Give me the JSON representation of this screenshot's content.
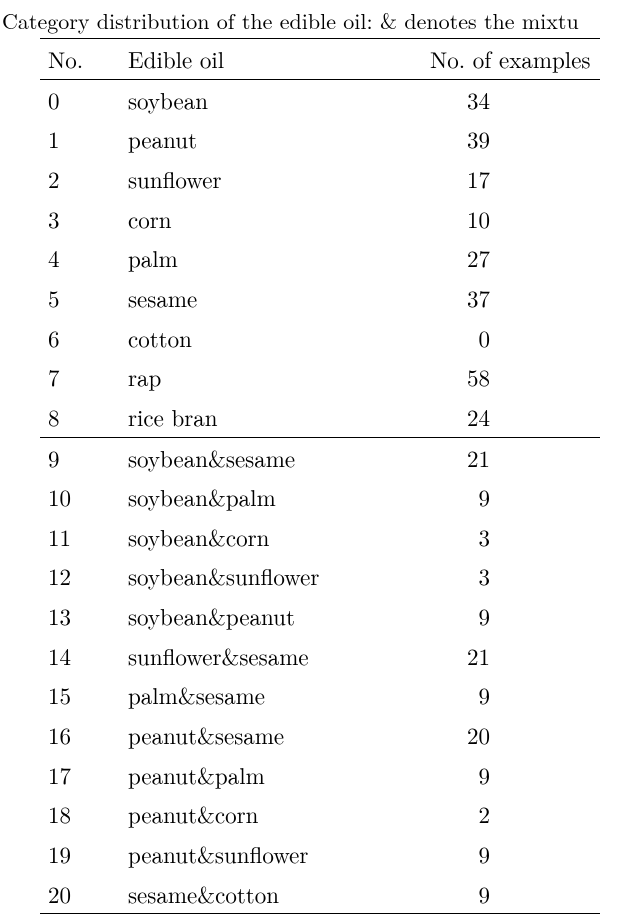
{
  "caption": "Category distribution of the edible oil: & denotes the mixtu",
  "columns": [
    "No.",
    "Edible oil",
    "No. of examples"
  ],
  "section_break_after": 8,
  "rows": [
    {
      "no": 0,
      "name": "soybean",
      "count": 34
    },
    {
      "no": 1,
      "name": "peanut",
      "count": 39
    },
    {
      "no": 2,
      "name": "sunflower",
      "count": 17
    },
    {
      "no": 3,
      "name": "corn",
      "count": 10
    },
    {
      "no": 4,
      "name": "palm",
      "count": 27
    },
    {
      "no": 5,
      "name": "sesame",
      "count": 37
    },
    {
      "no": 6,
      "name": "cotton",
      "count": 0
    },
    {
      "no": 7,
      "name": "rap",
      "count": 58
    },
    {
      "no": 8,
      "name": "rice bran",
      "count": 24
    },
    {
      "no": 9,
      "name": "soybean&sesame",
      "count": 21
    },
    {
      "no": 10,
      "name": "soybean&palm",
      "count": 9
    },
    {
      "no": 11,
      "name": "soybean&corn",
      "count": 3
    },
    {
      "no": 12,
      "name": "soybean&sunflower",
      "count": 3
    },
    {
      "no": 13,
      "name": "soybean&peanut",
      "count": 9
    },
    {
      "no": 14,
      "name": "sunflower&sesame",
      "count": 21
    },
    {
      "no": 15,
      "name": "palm&sesame",
      "count": 9
    },
    {
      "no": 16,
      "name": "peanut&sesame",
      "count": 20
    },
    {
      "no": 17,
      "name": "peanut&palm",
      "count": 9
    },
    {
      "no": 18,
      "name": "peanut&corn",
      "count": 2
    },
    {
      "no": 19,
      "name": "peanut&sunflower",
      "count": 9
    },
    {
      "no": 20,
      "name": "sesame&cotton",
      "count": 9
    }
  ]
}
